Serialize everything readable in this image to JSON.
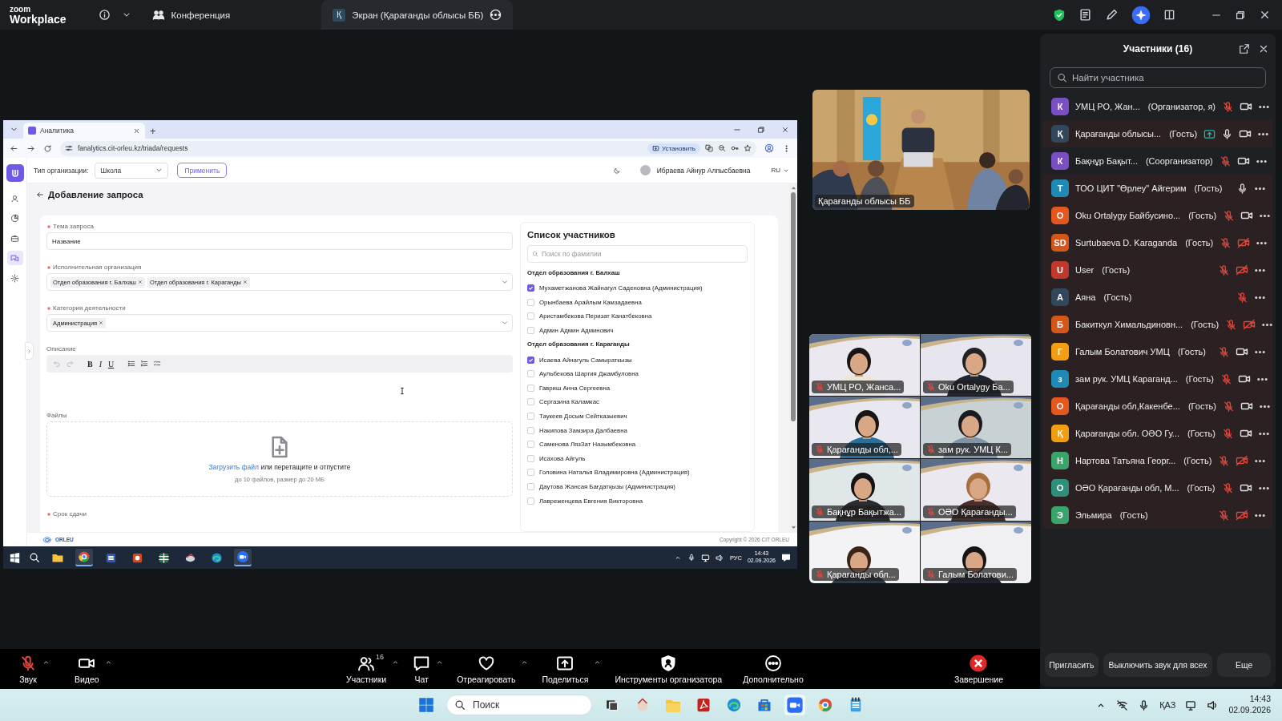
{
  "zoom_bar": {
    "logo_top": "zoom",
    "logo_bottom": "Workplace",
    "tabs": [
      {
        "label": "Конференция",
        "selected": false
      },
      {
        "label": "Экран (Қарағанды облысы ББ)",
        "avatar": "Қ",
        "selected": true
      }
    ]
  },
  "shared_screen": {
    "browser": {
      "tab": "Аналитика",
      "new_tab": "+",
      "url": "fanalytics.cit-orleu.kz/triada/requests",
      "install": "Установить"
    },
    "app": {
      "rail": [
        {
          "kind": "profile",
          "selected": false
        },
        {
          "kind": "chart",
          "selected": false
        },
        {
          "kind": "briefcase",
          "selected": false
        },
        {
          "kind": "chat",
          "selected": true
        },
        {
          "kind": "settings",
          "selected": false
        }
      ],
      "org_type_label": "Тип организации:",
      "org_type": "Школа",
      "apply": "Применить",
      "user": "Ибраева Айнур Алпысбаевна",
      "lang": "RU",
      "page_title": "Добавление запроса",
      "fields": [
        {
          "kind": "text",
          "label": "Тема запроса",
          "required": true,
          "value": "Название"
        },
        {
          "kind": "tags",
          "label": "Исполнительная организация",
          "required": true,
          "tags": [
            "Отдел образования г. Балхаш",
            "Отдел образования г. Караганды"
          ]
        },
        {
          "kind": "tags",
          "label": "Категория деятельности",
          "required": true,
          "tags": [
            "Администрация"
          ]
        },
        {
          "kind": "editor",
          "label": "Описание",
          "required": false,
          "format_buttons": [
            "B",
            "I",
            "U"
          ]
        },
        {
          "kind": "upload",
          "label": "Файлы",
          "required": false,
          "link": "Загрузить файл",
          "text": " или перетащите и отпустите",
          "hint": "до 10 файлов, размер до 20 МБ"
        },
        {
          "kind": "date",
          "label": "Срок сдачи",
          "required": true
        }
      ],
      "participants_list": {
        "title": "Список участников",
        "search_placeholder": "Поиск по фамилии",
        "groups": [
          {
            "name": "Отдел образования г. Балхаш",
            "members": [
              {
                "name": "Мухаметжанова Жайнагул Саденовна (Администрация)",
                "checked": true
              },
              {
                "name": "Орынбаева Арайлым Камзадаевна",
                "checked": false
              },
              {
                "name": "Аристамбекова Перизат Канатбековна",
                "checked": false
              },
              {
                "name": "Админ Админ Админович",
                "checked": false
              }
            ]
          },
          {
            "name": "Отдел образования г. Караганды",
            "members": [
              {
                "name": "Исаева Айнагуль Самыраткызы",
                "checked": true
              },
              {
                "name": "Аульбекова Шаргия Джамбуловна",
                "checked": false
              },
              {
                "name": "Гавриш Анна Сергеевна",
                "checked": false
              },
              {
                "name": "Сергазина Каламкас",
                "checked": false
              },
              {
                "name": "Таукеев Досым Сейтказыевич",
                "checked": false
              },
              {
                "name": "Накипова Замзира Далбаевна",
                "checked": false
              },
              {
                "name": "Саменова ЛязЗат Назымбековна",
                "checked": false
              },
              {
                "name": "Исахова Айгуль",
                "checked": false
              },
              {
                "name": "Головина Наталья Владимировна (Администрация)",
                "checked": false
              },
              {
                "name": "Даутова Жансая Бағдатқызы (Администрация)",
                "checked": false
              },
              {
                "name": "Лавреженцева Евгения Викторовна",
                "checked": false
              }
            ]
          }
        ]
      },
      "footer": {
        "logo": "ORLEU",
        "copyright": "Copyright © 2026 CIT ORLEU"
      }
    },
    "taskbar": {
      "lang": "РУС",
      "time": "14:43",
      "date": "02.09.2026"
    }
  },
  "videos": {
    "main": {
      "label": "Қарағанды облысы ББ"
    },
    "tiles": [
      {
        "label": "УМЦ РО, Жанса...",
        "muted": true
      },
      {
        "label": "Oku Ortalygy Ба...",
        "muted": true
      },
      {
        "label": "Қарағанды обл,...",
        "muted": true
      },
      {
        "label": "зам рук. УМЦ К...",
        "muted": true
      },
      {
        "label": "Бақнұр Бақытжа...",
        "muted": true
      },
      {
        "label": "ОӘО Қарағанды...",
        "muted": true
      },
      {
        "label": "Қарағанды обл...",
        "muted": true
      },
      {
        "label": "Галым Болатови...",
        "muted": true
      }
    ]
  },
  "participants": {
    "title": "Участники (16)",
    "search_placeholder": "Найти участника",
    "items": [
      {
        "avatar": "К",
        "color": "#7b4fc4",
        "name": "УМЦ РО, Жан...",
        "role": "(Организатор, я)",
        "sharing": false,
        "muted": true,
        "video_on": true,
        "highlighted": false
      },
      {
        "avatar": "Қ",
        "color": "#30475c",
        "name": "Қарағанды облысы...",
        "role": "(Гость)",
        "sharing": true,
        "muted": false,
        "video_on": true,
        "highlighted": true
      },
      {
        "avatar": "К",
        "color": "#7b4fc4",
        "name": "Бақнұр Бақыт...",
        "role": "(Соорганизатор)",
        "sharing": false,
        "muted": true,
        "video_on": true,
        "highlighted": false
      },
      {
        "avatar": "Т",
        "color": "#1f8ab5",
        "name": "ТОО ЦИТ \"Өрлеу\" Айгерим",
        "role": "(Гость)",
        "sharing": false,
        "muted": false,
        "highlighted": true
      },
      {
        "avatar": "О",
        "color": "#e4571f",
        "name": "Oku Ortalygy Байбусино...",
        "role": "(Гость)",
        "sharing": false,
        "muted": true,
        "video_on": true,
        "highlighted": true
      },
      {
        "avatar": "SD",
        "color": "#d4561b",
        "name": "Surtubaeva D. Karaganda",
        "role": "(Гость)",
        "sharing": false,
        "muted": true,
        "video_on": false,
        "highlighted": true
      },
      {
        "avatar": "U",
        "color": "#c0392b",
        "name": "User",
        "role": "(Гость)",
        "sharing": false,
        "muted": true,
        "video_on": false,
        "highlighted": true
      },
      {
        "avatar": "А",
        "color": "#30475c",
        "name": "Аяна",
        "role": "(Гость)",
        "sharing": false,
        "muted": true,
        "highlighted": true
      },
      {
        "avatar": "Б",
        "color": "#d4561b",
        "name": "Бакиткул Химальдиновн...",
        "role": "(Гость)",
        "sharing": false,
        "muted": true,
        "video_on": false,
        "highlighted": true
      },
      {
        "avatar": "Г",
        "color": "#f29d12",
        "name": "Галым Болатович УМЦ",
        "role": "(Гость)",
        "sharing": false,
        "muted": true,
        "video_on": true,
        "highlighted": true
      },
      {
        "avatar": "з",
        "color": "#1f8ab5",
        "name": "зам рук. УМЦ Караганд...",
        "role": "(Гость)",
        "sharing": false,
        "muted": true,
        "video_on": true,
        "highlighted": true
      },
      {
        "avatar": "О",
        "color": "#e4571f",
        "name": "Қарағанды обл,Какенбе...",
        "role": "(Гость)",
        "sharing": false,
        "muted": true,
        "video_on": true,
        "highlighted": true
      },
      {
        "avatar": "Қ",
        "color": "#f29d12",
        "name": "Қарағанды обл. ОӘО Гу...",
        "role": "(Гость)",
        "sharing": false,
        "muted": true,
        "video_on": true,
        "highlighted": true
      },
      {
        "avatar": "Н",
        "color": "#3aa56b",
        "name": "Нартова Татьяна Георг...",
        "role": "(Гость)",
        "sharing": false,
        "muted": true,
        "video_on": false,
        "highlighted": true
      },
      {
        "avatar": "О",
        "color": "#2f8f7a",
        "name": "ОӘО Қарағанды обл, М...",
        "role": "(Гость)",
        "sharing": false,
        "muted": true,
        "video_on": true,
        "highlighted": true
      },
      {
        "avatar": "Э",
        "color": "#3aa56b",
        "name": "Эльмира",
        "role": "(Гость)",
        "sharing": false,
        "muted": true,
        "video_on": false,
        "highlighted": true
      }
    ],
    "buttons": [
      "Пригласить",
      "Выключить звук для всех",
      "Еще"
    ]
  },
  "toolbar": {
    "items": [
      {
        "kind": "audio",
        "label": "Звук",
        "caret": true,
        "muted": true
      },
      {
        "kind": "video",
        "label": "Видео",
        "caret": true
      },
      {
        "kind": "participants",
        "label": "Участники",
        "count": "16",
        "caret": true
      },
      {
        "kind": "chat",
        "label": "Чат",
        "caret": true
      },
      {
        "kind": "react",
        "label": "Отреагировать",
        "caret": true
      },
      {
        "kind": "share",
        "label": "Поделиться",
        "caret": true
      },
      {
        "kind": "host-tools",
        "label": "Инструменты организатора",
        "caret": false
      },
      {
        "kind": "more",
        "label": "Дополнительно",
        "caret": false
      },
      {
        "kind": "end",
        "label": "Завершение",
        "caret": false
      }
    ]
  },
  "taskbar": {
    "search_placeholder": "Поиск",
    "lang": "ҚАЗ",
    "time": "14:43",
    "date": "02.09.2026"
  }
}
